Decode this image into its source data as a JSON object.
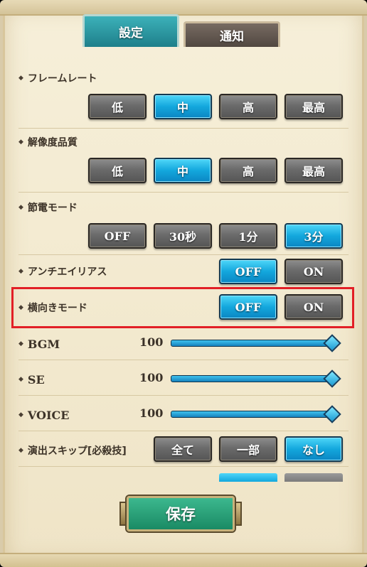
{
  "tabs": [
    {
      "label": "設定",
      "active": true
    },
    {
      "label": "通知",
      "active": false
    }
  ],
  "settings": {
    "frame_rate": {
      "label": "フレームレート",
      "options": [
        "低",
        "中",
        "高",
        "最高"
      ],
      "selected": "中"
    },
    "resolution": {
      "label": "解像度品質",
      "options": [
        "低",
        "中",
        "高",
        "最高"
      ],
      "selected": "中"
    },
    "power_save": {
      "label": "節電モード",
      "options": [
        "OFF",
        "30秒",
        "1分",
        "3分"
      ],
      "selected": "3分"
    },
    "antialias": {
      "label": "アンチエイリアス",
      "options": [
        "OFF",
        "ON"
      ],
      "selected": "OFF"
    },
    "landscape": {
      "label": "横向きモード",
      "options": [
        "OFF",
        "ON"
      ],
      "selected": "OFF"
    },
    "bgm": {
      "label": "BGM",
      "value": "100",
      "level": 1.0
    },
    "se": {
      "label": "SE",
      "value": "100",
      "level": 1.0
    },
    "voice": {
      "label": "VOICE",
      "value": "100",
      "level": 1.0
    },
    "effect_skip": {
      "label": "演出スキップ[必殺技]",
      "options": [
        "全て",
        "一部",
        "なし"
      ],
      "selected": "なし"
    }
  },
  "save_label": "保存",
  "colors": {
    "selected": "#13a7dd",
    "unselected": "#6b6b6b",
    "tab_active": "#2a98a2",
    "save": "#22996f",
    "highlight_border": "#e21f26"
  }
}
